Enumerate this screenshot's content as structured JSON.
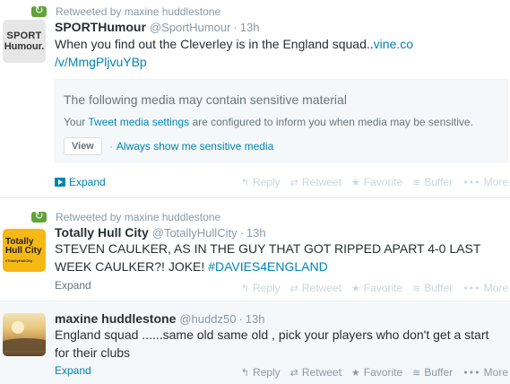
{
  "tweets": [
    {
      "retweeted_by": "Retweeted by maxine huddlestone",
      "avatar_text": [
        "SPORT",
        "Humour."
      ],
      "fullname": "SPORTHumour",
      "handle": "@SportHumour",
      "separator": "·",
      "time": "13h",
      "text_parts": [
        "When you find out the Cleverley is in the England squad..",
        "vine.co",
        "/v/MmgPljvuYBp"
      ],
      "sensitive": {
        "title": "The following media may contain sensitive material",
        "info_prefix": "Your ",
        "info_link": "Tweet media settings",
        "info_suffix": " are configured to inform you when media may be sensitive.",
        "view_button": "View",
        "bullet": "·",
        "always_show": "Always show me sensitive media"
      },
      "expand": "Expand"
    },
    {
      "retweeted_by": "Retweeted by maxine huddlestone",
      "avatar_text": [
        "Totally",
        "Hull City",
        "#TotallyHullCity"
      ],
      "fullname": "Totally Hull City",
      "handle": "@TotallyHullCity",
      "separator": "·",
      "time": "13h",
      "text_line1": "STEVEN CAULKER, AS IN THE GUY THAT GOT RIPPED APART 4-0 LAST",
      "text_line2": "WEEK CAULKER?! JOKE! ",
      "hashtag": "#DAVIES4ENGLAND",
      "expand": "Expand"
    },
    {
      "fullname": "maxine huddlestone",
      "handle": "@huddz50",
      "separator": "·",
      "time": "13h",
      "text_line1": "England squad ......same old same old , pick your players who don't get a start",
      "text_line2": "for their clubs",
      "expand": "Expand"
    }
  ],
  "actions": {
    "reply": "Reply",
    "retweet": "Retweet",
    "favorite": "Favorite",
    "buffer": "Buffer",
    "more": "More"
  },
  "icons": {
    "reply": "reply-arrow-icon",
    "retweet": "retweet-icon",
    "favorite": "star-icon",
    "buffer": "buffer-stack-icon",
    "more": "ellipsis-icon",
    "expand": "play-icon"
  },
  "colors": {
    "link": "#0084b4",
    "retweet_badge": "#5fa33a",
    "muted": "#8899a6",
    "hull_avatar": "#f6b814"
  }
}
